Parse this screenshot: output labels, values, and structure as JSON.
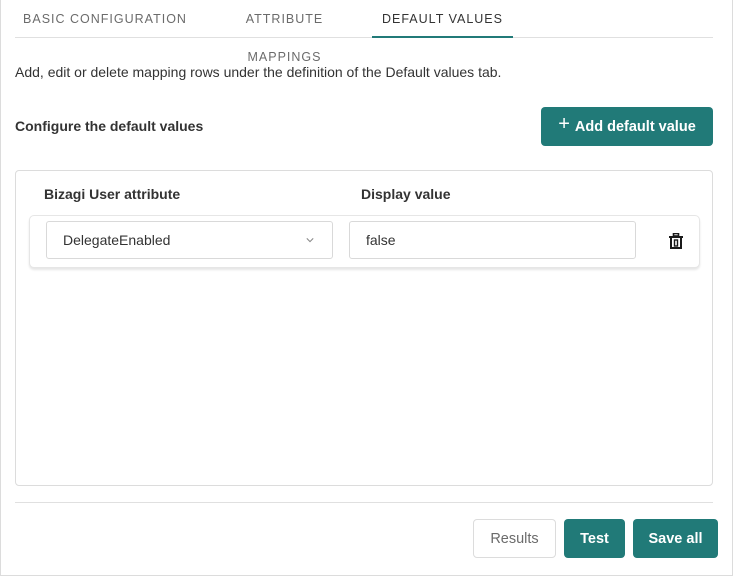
{
  "tabs": [
    {
      "label": "BASIC CONFIGURATION",
      "active": false
    },
    {
      "label": "ATTRIBUTE MAPPINGS",
      "active": false
    },
    {
      "label": "DEFAULT VALUES",
      "active": true
    }
  ],
  "description": "Add, edit or delete mapping rows under the definition of the Default values tab.",
  "section_title": "Configure the default values",
  "add_button": {
    "icon": "plus-icon",
    "label": "Add default value"
  },
  "table": {
    "columns": [
      "Bizagi User attribute",
      "Display value"
    ],
    "rows": [
      {
        "attribute": "DelegateEnabled",
        "value": "false",
        "delete_icon": "trash-icon"
      }
    ]
  },
  "footer": {
    "results_label": "Results",
    "test_label": "Test",
    "save_label": "Save all"
  },
  "colors": {
    "accent": "#217a78",
    "text": "#333333",
    "muted": "#6b6b6b",
    "border": "#dcdcdc"
  }
}
